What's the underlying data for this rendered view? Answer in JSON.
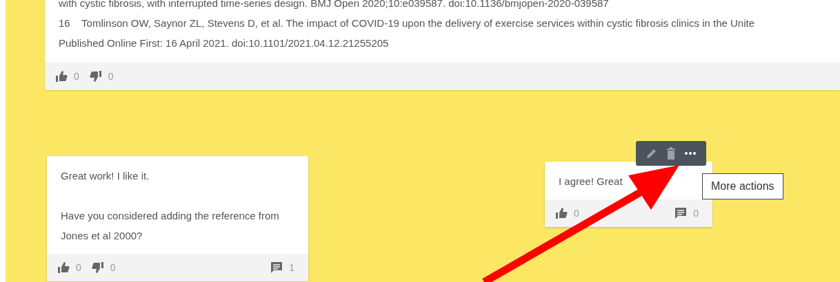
{
  "reference_list": {
    "lines": [
      "with cystic fibrosis, with interrupted time-series design. BMJ Open 2020;10:e039587. doi:10.1136/bmjopen-2020-039587",
      "16    Tomlinson OW, Saynor ZL, Stevens D, et al. The impact of COVID-19 upon the delivery of exercise services within cystic fibrosis clinics in the Unite",
      "Published Online First: 16 April 2021. doi:10.1101/2021.04.12.21255205"
    ],
    "likes": "0",
    "dislikes": "0"
  },
  "comments": [
    {
      "paragraphs": [
        "Great work! I like it.",
        "Have you considered adding the reference from Jones et al 2000?"
      ],
      "likes": "0",
      "dislikes": "0",
      "replies": "1",
      "toolbar": false
    },
    {
      "paragraphs": [
        "I agree! Great"
      ],
      "likes": "0",
      "replies": "0",
      "toolbar": true
    }
  ],
  "tooltip": "More actions",
  "annotation_arrow": true
}
